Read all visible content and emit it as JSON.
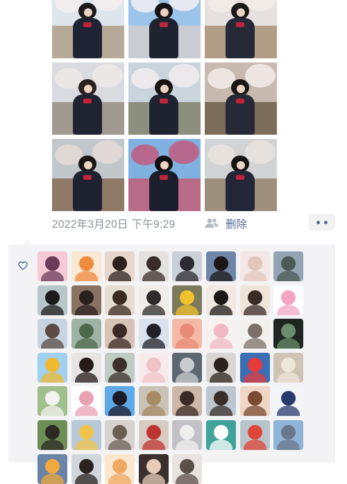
{
  "post": {
    "timestamp": "2022年3月20日 下午9:29",
    "delete_label": "删除"
  },
  "photos": [
    {
      "sky": "#dfe5ec",
      "ground": "#b7aa99",
      "blossom": "#f4eef0",
      "hair": "#1d1a1a",
      "uniform": "#1f2434"
    },
    {
      "sky": "#9cc4ea",
      "ground": "#c9ccd3",
      "blossom": "#f3f0f2",
      "hair": "#151313",
      "uniform": "#1e2330"
    },
    {
      "sky": "#e6e1df",
      "ground": "#b19d85",
      "blossom": "#f2ecea",
      "hair": "#1b1818",
      "uniform": "#262a38"
    },
    {
      "sky": "#d9dbe0",
      "ground": "#a19a90",
      "blossom": "#efe9e7",
      "hair": "#2a201c",
      "uniform": "#1f2332"
    },
    {
      "sky": "#c9d4dd",
      "ground": "#8c8f7d",
      "blossom": "#f1ecef",
      "hair": "#171313",
      "uniform": "#1f2331"
    },
    {
      "sky": "#c7b9ad",
      "ground": "#7c6c5a",
      "blossom": "#f3ecea",
      "hair": "#1b1616",
      "uniform": "#272a36"
    },
    {
      "sky": "#c2c7cb",
      "ground": "#8e7a66",
      "blossom": "#e4dbd6",
      "hair": "#1a1616",
      "uniform": "#1e2231"
    },
    {
      "sky": "#7fb1e1",
      "ground": "#b86b86",
      "blossom": "#c25c7c",
      "hair": "#111010",
      "uniform": "#1b1f2c"
    },
    {
      "sky": "#d1d3d5",
      "ground": "#9d8f7c",
      "blossom": "#ebe3df",
      "hair": "#161313",
      "uniform": "#222636"
    }
  ],
  "likes": {
    "avatars": [
      {
        "icon": "avatar-cartoon-girl",
        "bg": "#f7c9d6",
        "fg": "#6a3b58"
      },
      {
        "icon": "avatar-goldfish",
        "bg": "#fbe8d3",
        "fg": "#f08a3c"
      },
      {
        "icon": "avatar-portrait",
        "bg": "#e8d6cc",
        "fg": "#2c1f1c"
      },
      {
        "icon": "avatar-portrait",
        "bg": "#e4e2df",
        "fg": "#3a2c28"
      },
      {
        "icon": "avatar-anime-girl",
        "bg": "#c9d0d8",
        "fg": "#2b2a30"
      },
      {
        "icon": "avatar-portrait",
        "bg": "#6f86a8",
        "fg": "#1c1717"
      },
      {
        "icon": "avatar-peace-hand",
        "bg": "#f2e6e6",
        "fg": "#e3c7b9"
      },
      {
        "icon": "avatar-landscape",
        "bg": "#94a3b3",
        "fg": "#4b5b54"
      },
      {
        "icon": "avatar-portrait",
        "bg": "#b6c6c9",
        "fg": "#1c1a1a"
      },
      {
        "icon": "avatar-portrait",
        "bg": "#8a7263",
        "fg": "#2a211d"
      },
      {
        "icon": "avatar-portrait",
        "bg": "#e6ddd2",
        "fg": "#3b2a22"
      },
      {
        "icon": "avatar-sketch-girl",
        "bg": "#f0ede9",
        "fg": "#2e2b2b"
      },
      {
        "icon": "avatar-sunflower-girl",
        "bg": "#7b7a5a",
        "fg": "#f2c12e"
      },
      {
        "icon": "avatar-portrait",
        "bg": "#f3e9e3",
        "fg": "#1c1818"
      },
      {
        "icon": "avatar-portrait",
        "bg": "#efe4da",
        "fg": "#3a2b25"
      },
      {
        "icon": "avatar-cartoon-girl",
        "bg": "#ffffff",
        "fg": "#f2a4c0"
      },
      {
        "icon": "avatar-portrait",
        "bg": "#c7d5e2",
        "fg": "#5b4b44"
      },
      {
        "icon": "avatar-landscape",
        "bg": "#9fb3a5",
        "fg": "#4d6a4b"
      },
      {
        "icon": "avatar-portrait",
        "bg": "#d7c3b6",
        "fg": "#3a2a24"
      },
      {
        "icon": "avatar-portrait",
        "bg": "#d9e2ee",
        "fg": "#202028"
      },
      {
        "icon": "avatar-cartoon-pig",
        "bg": "#f3b9a5",
        "fg": "#e98a76"
      },
      {
        "icon": "avatar-cartoon-cats",
        "bg": "#f7f1f0",
        "fg": "#f2b8c4"
      },
      {
        "icon": "avatar-text-note",
        "bg": "#f3f1ee",
        "fg": "#7b6f67"
      },
      {
        "icon": "avatar-night-scene",
        "bg": "#1f2621",
        "fg": "#6a8e6b"
      },
      {
        "icon": "avatar-winnie-pooh",
        "bg": "#9fd0f0",
        "fg": "#f2b830"
      },
      {
        "icon": "avatar-portrait",
        "bg": "#e8e4e2",
        "fg": "#241b19"
      },
      {
        "icon": "avatar-portrait",
        "bg": "#c0cbc4",
        "fg": "#3b302c"
      },
      {
        "icon": "avatar-cartoon-bear",
        "bg": "#f6eaea",
        "fg": "#f1c2c8"
      },
      {
        "icon": "avatar-pet",
        "bg": "#5c6770",
        "fg": "#c9ccce"
      },
      {
        "icon": "avatar-portrait",
        "bg": "#d9d5d2",
        "fg": "#2c211d"
      },
      {
        "icon": "avatar-cartoon-mario",
        "bg": "#3a6fb6",
        "fg": "#e53b3b"
      },
      {
        "icon": "avatar-plush",
        "bg": "#cfc3b5",
        "fg": "#efe6da"
      },
      {
        "icon": "avatar-sheep",
        "bg": "#9fbf8d",
        "fg": "#f4f2ee"
      },
      {
        "icon": "avatar-sketch-girl",
        "bg": "#ffffff",
        "fg": "#e8a2b3"
      },
      {
        "icon": "avatar-cartoon-boy",
        "bg": "#5fa9e8",
        "fg": "#1c1c28"
      },
      {
        "icon": "avatar-dog",
        "bg": "#c9c2b7",
        "fg": "#a68a64"
      },
      {
        "icon": "avatar-anime-girl",
        "bg": "#cdb8a8",
        "fg": "#3b2b25"
      },
      {
        "icon": "avatar-portrait",
        "bg": "#bcc6cf",
        "fg": "#3a2d28"
      },
      {
        "icon": "avatar-portrait",
        "bg": "#efd6c6",
        "fg": "#7a4b33"
      },
      {
        "icon": "avatar-cartoon-boy",
        "bg": "#f2f4f7",
        "fg": "#283a6e"
      },
      {
        "icon": "avatar-pet",
        "bg": "#6d8f55",
        "fg": "#2d2a26"
      },
      {
        "icon": "avatar-cartoon-bear",
        "bg": "#b7c9d6",
        "fg": "#f2c34b"
      },
      {
        "icon": "avatar-cat",
        "bg": "#d9d3cf",
        "fg": "#6b5e57"
      },
      {
        "icon": "avatar-portrait",
        "bg": "#d7ccc2",
        "fg": "#c0342f"
      },
      {
        "icon": "avatar-cat",
        "bg": "#c2c2c6",
        "fg": "#f1efee"
      },
      {
        "icon": "avatar-text-logo",
        "bg": "#3fa39b",
        "fg": "#ffffff"
      },
      {
        "icon": "avatar-panda",
        "bg": "#b8c4cc",
        "fg": "#e0453a"
      },
      {
        "icon": "avatar-cityscape",
        "bg": "#8fb4d8",
        "fg": "#6b778a"
      },
      {
        "icon": "avatar-winnie-pooh",
        "bg": "#6a84a8",
        "fg": "#f0a93a"
      },
      {
        "icon": "avatar-portrait",
        "bg": "#cfd6dc",
        "fg": "#2a2220"
      },
      {
        "icon": "avatar-cartoon-pig",
        "bg": "#fbe7cf",
        "fg": "#f0a862"
      },
      {
        "icon": "avatar-portrait",
        "bg": "#3a2f2a",
        "fg": "#e7cdb8"
      },
      {
        "icon": "avatar-portrait",
        "bg": "#e9e3df",
        "fg": "#5b4f4a"
      }
    ]
  }
}
